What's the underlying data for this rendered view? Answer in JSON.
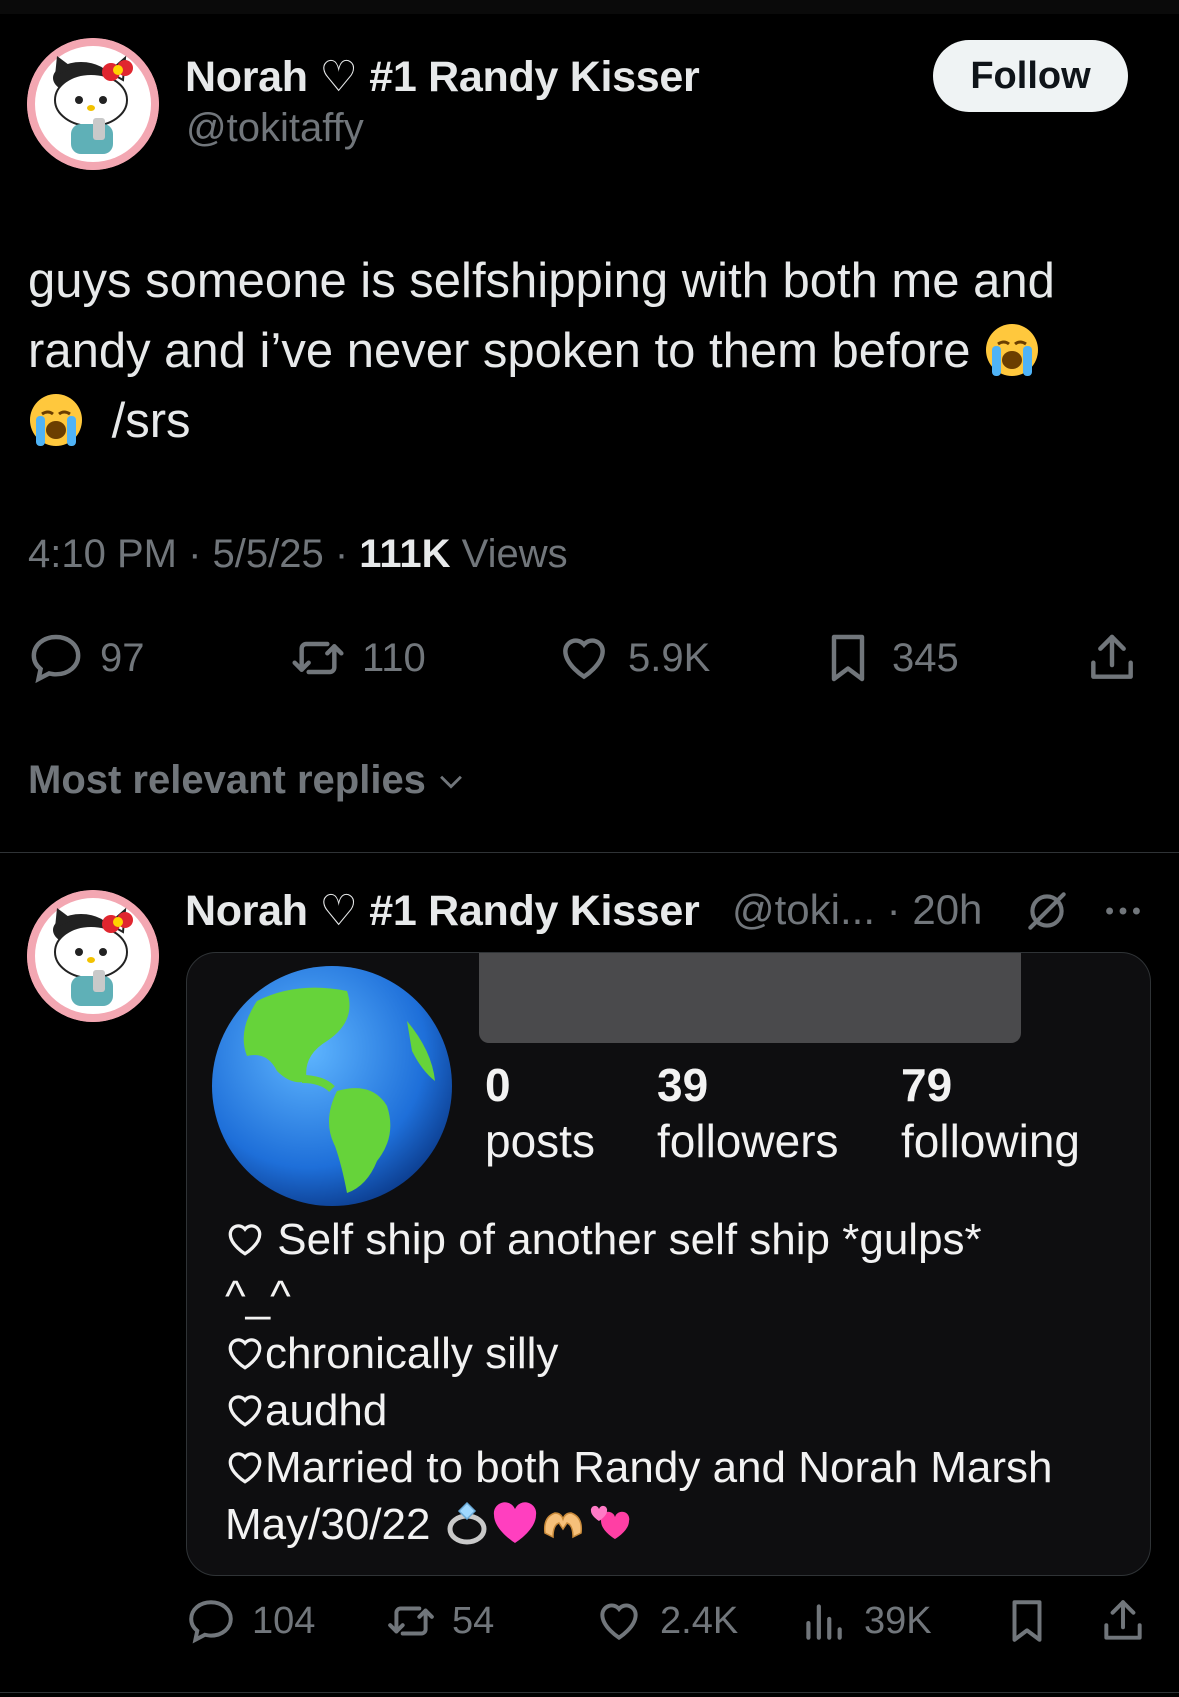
{
  "main_tweet": {
    "author_name": "Norah ♡ #1 Randy Kisser",
    "handle": "@tokitaffy",
    "follow_label": "Follow",
    "text_line1": "guys someone is selfshipping with both me and",
    "text_line2": "randy and i’ve never spoken to them before",
    "text_line3": "/srs",
    "time": "4:10 PM",
    "date": "5/5/25",
    "views_count": "111K",
    "views_label": "Views",
    "replies": "97",
    "reposts": "110",
    "likes": "5.9K",
    "bookmarks": "345"
  },
  "replies_sort_label": "Most relevant replies",
  "reply": {
    "author_name": "Norah ♡ #1 Randy Kisser",
    "handle_truncated": "@toki...",
    "age": "20h",
    "replies": "104",
    "reposts": "54",
    "likes": "2.4K",
    "views": "39K"
  },
  "attached_image": {
    "posts_count": "0",
    "posts_label": "posts",
    "followers_count": "39",
    "followers_label": "followers",
    "following_count": "79",
    "following_label": "following",
    "bio_line1": "Self ship of another self ship *gulps*",
    "bio_line2": "^_^",
    "bio_line3": "chronically silly",
    "bio_line4": "audhd",
    "bio_line5": "Married to both Randy and Norah Marsh",
    "bio_line6": "May/30/22"
  },
  "colors": {
    "background": "#000000",
    "text_primary": "#e7e9ea",
    "text_secondary": "#71767b",
    "divider": "#2f3336",
    "follow_button_bg": "#eff3f4"
  }
}
